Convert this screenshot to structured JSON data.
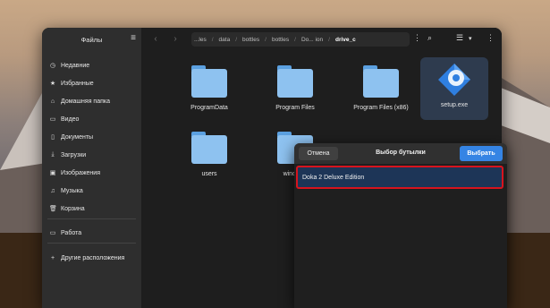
{
  "sidebar": {
    "title": "Файлы",
    "items": [
      {
        "icon": "clock-icon",
        "glyph": "◷",
        "label": "Недавние"
      },
      {
        "icon": "star-icon",
        "glyph": "★",
        "label": "Избранные"
      },
      {
        "icon": "home-icon",
        "glyph": "⌂",
        "label": "Домашняя папка"
      },
      {
        "icon": "video-icon",
        "glyph": "▭",
        "label": "Видео"
      },
      {
        "icon": "document-icon",
        "glyph": "▯",
        "label": "Документы"
      },
      {
        "icon": "download-icon",
        "glyph": "⤓",
        "label": "Загрузки"
      },
      {
        "icon": "image-icon",
        "glyph": "▣",
        "label": "Изображения"
      },
      {
        "icon": "music-icon",
        "glyph": "♫",
        "label": "Музыка"
      },
      {
        "icon": "trash-icon",
        "glyph": "🗑",
        "label": "Корзина"
      },
      {
        "icon": "folder-icon",
        "glyph": "▭",
        "label": "Работа"
      },
      {
        "icon": "plus-icon",
        "glyph": "+",
        "label": "Другие расположения"
      }
    ]
  },
  "toolbar": {
    "path": [
      "...les",
      "data",
      "bottles",
      "bottles",
      "Do... ion",
      "drive_c"
    ]
  },
  "files": [
    {
      "name": "ProgramData",
      "type": "folder"
    },
    {
      "name": "Program Files",
      "type": "folder"
    },
    {
      "name": "Program Files (x86)",
      "type": "folder"
    },
    {
      "name": "setup.exe",
      "type": "exe"
    },
    {
      "name": "users",
      "type": "folder"
    },
    {
      "name": "windows",
      "type": "folder"
    }
  ],
  "dialog": {
    "cancel_label": "Отмена",
    "title": "Выбор бутылки",
    "select_label": "Выбрать",
    "bottles": [
      "Doka 2 Deluxe Edition"
    ]
  },
  "colors": {
    "accent": "#3584e4",
    "highlight_border": "#d7141e",
    "folder": "#8ec2f0"
  }
}
